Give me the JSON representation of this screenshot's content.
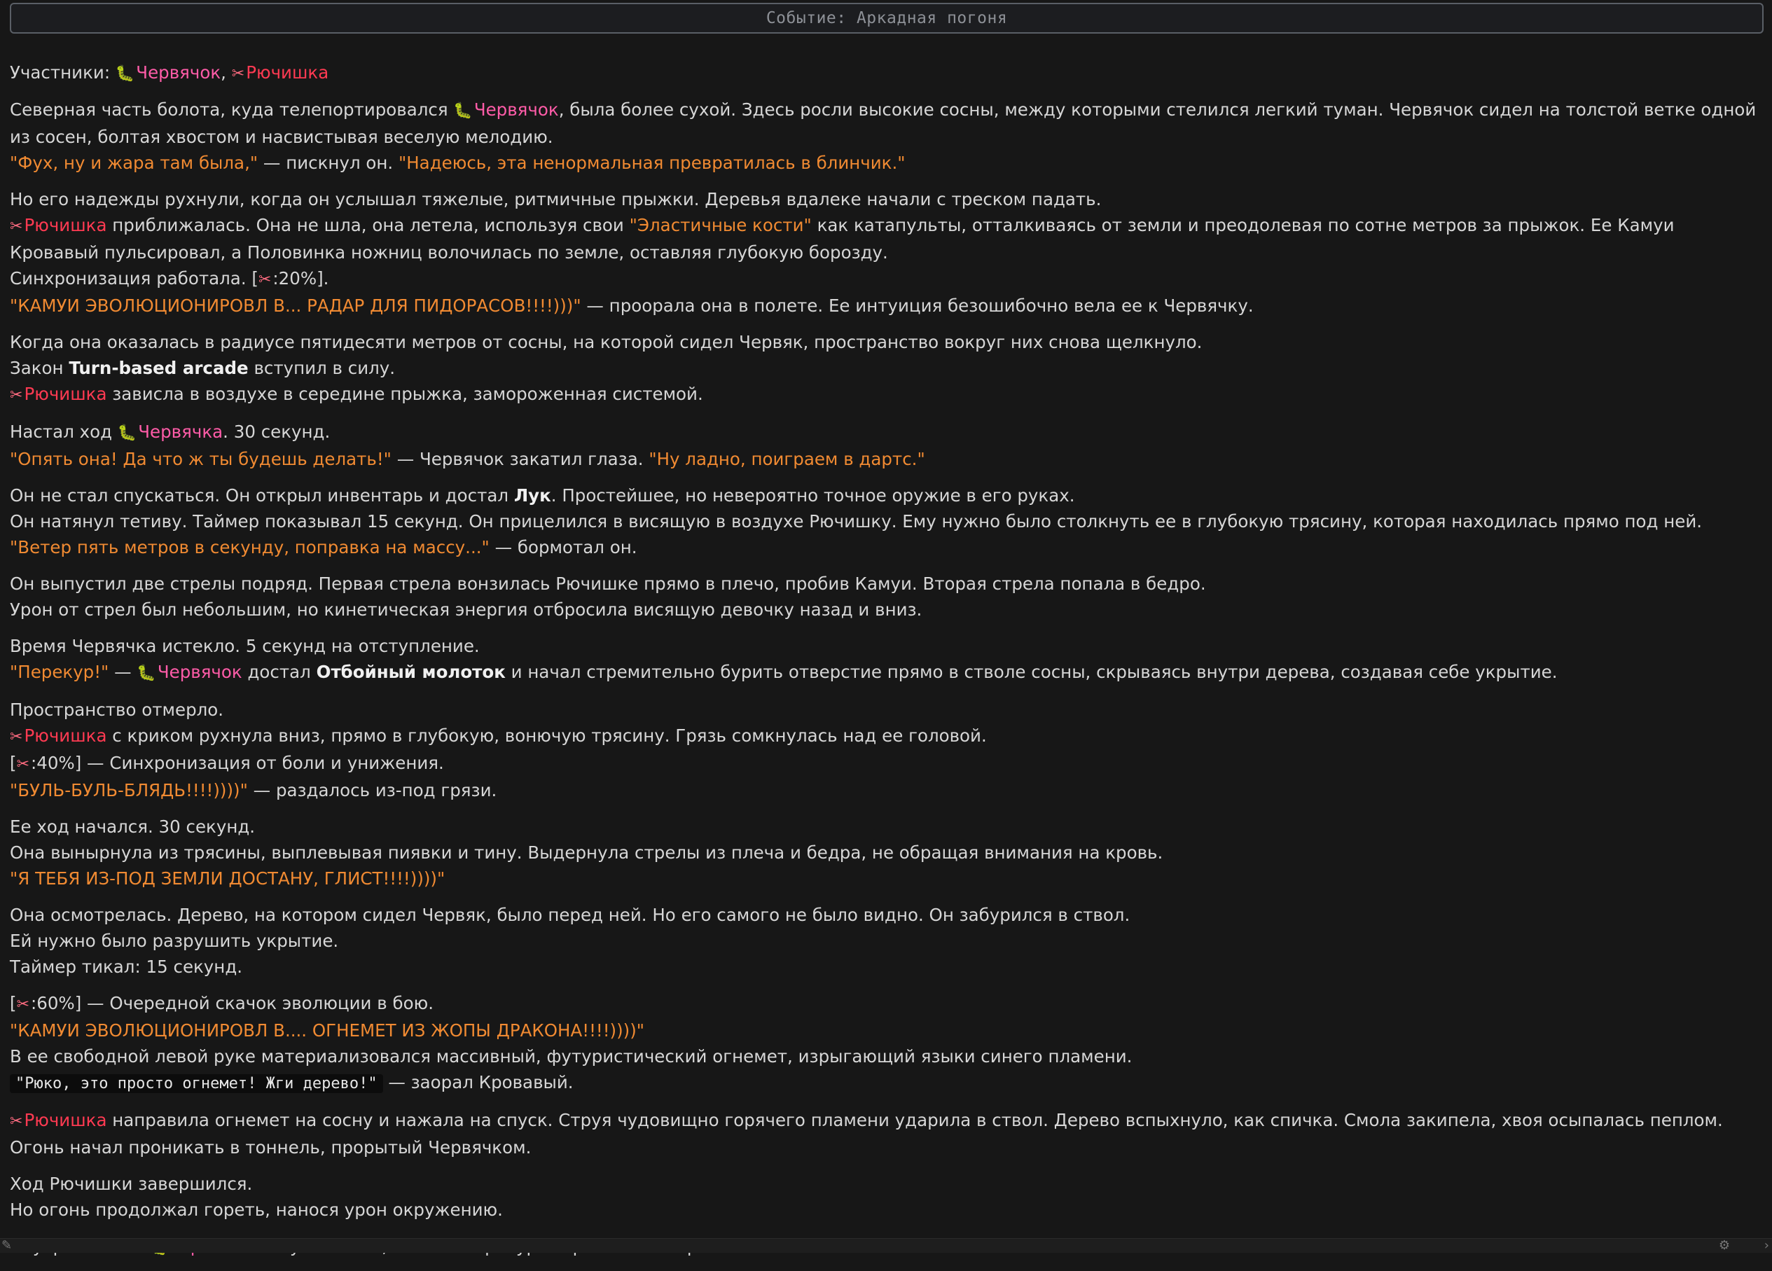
{
  "header": {
    "title": "Событие: Аркадная погоня"
  },
  "names": {
    "worm": "Червячок",
    "worm_gen": "Червячка",
    "ryu": "Рючишка"
  },
  "icons": {
    "worm": "caterpillar-icon",
    "ryu": "scissors-icon"
  },
  "colors": {
    "quote": "#f08a32",
    "worm_name": "#ff5ca8",
    "ryu_name": "#ff3a52",
    "background": "#171717"
  },
  "text": {
    "participants_label": "Участники:",
    "comma": ",",
    "p2_pre": "Северная часть болота, куда телепортировался",
    "p2_post": ", была более сухой. Здесь росли высокие сосны, между которыми стелился легкий туман. Червячок сидел на толстой ветке одной из сосен, болтая хвостом и насвистывая веселую мелодию.",
    "p2_q1": "\"Фух, ну и жара там была,\"",
    "p2_mid": " — пискнул он. ",
    "p2_q2": "\"Надеюсь, эта ненормальная превратилась в блинчик.\"",
    "p3_l1": "Но его надежды рухнули, когда он услышал тяжелые, ритмичные прыжки. Деревья вдалеке начали с треском падать.",
    "p3_l2a": " приближалась. Она не шла, она летела, используя свои ",
    "p3_q1": "\"Эластичные кости\"",
    "p3_l2b": " как катапульты, отталкиваясь от земли и преодолевая по сотне метров за прыжок. Ее Камуи Кровавый пульсировал, а Половинка ножниц волочилась по земле, оставляя глубокую борозду.",
    "p3_l4a": "Синхронизация работала. [",
    "p3_l4b": ":20%].",
    "p3_q2": "\"КАМУИ ЭВОЛЮЦИОНИРОВЛ В... РАДАР ДЛЯ ПИДОРАСОВ!!!!)))\"",
    "p3_l5b": " — проорала она в полете. Ее интуиция безошибочно вела ее к Червячку.",
    "p4_l1": "Когда она оказалась в радиусе пятидесяти метров от сосны, на которой сидел Червяк, пространство вокруг них снова щелкнуло.",
    "p4_l2a": "Закон ",
    "p4_l2b": "Turn-based arcade",
    "p4_l2c": " вступил в силу.",
    "p4_l3": " зависла в воздухе в середине прыжка, замороженная системой.",
    "p5_l1a": "Настал ход ",
    "p5_l1b": ". 30 секунд.",
    "p5_q1": "\"Опять она! Да что ж ты будешь делать!\"",
    "p5_mid": " — Червячок закатил глаза. ",
    "p5_q2": "\"Ну ладно, поиграем в дартс.\"",
    "p6_l1a": "Он не стал спускаться. Он открыл инвентарь и достал ",
    "p6_l1b": "Лук",
    "p6_l1c": ". Простейшее, но невероятно точное оружие в его руках.",
    "p6_l2": "Он натянул тетиву. Таймер показывал 15 секунд. Он прицелился в висящую в воздухе Рючишку. Ему нужно было столкнуть ее в глубокую трясину, которая находилась прямо под ней.",
    "p6_q1": "\"Ветер пять метров в секунду, поправка на массу...\"",
    "p6_l3b": " — бормотал он.",
    "p7_l1": "Он выпустил две стрелы подряд. Первая стрела вонзилась Рючишке прямо в плечо, пробив Камуи. Вторая стрела попала в бедро.",
    "p7_l2": "Урон от стрел был небольшим, но кинетическая энергия отбросила висящую девочку назад и вниз.",
    "p8_l1": "Время Червячка истекло. 5 секунд на отступление.",
    "p8_q1": "\"Перекур!\"",
    "p8_dash": " — ",
    "p8_l2a": " достал ",
    "p8_l2b": "Отбойный молоток",
    "p8_l2c": " и начал стремительно бурить отверстие прямо в стволе сосны, скрываясь внутри дерева, создавая себе укрытие.",
    "p9_l1": "Пространство отмерло.",
    "p9_l2": " с криком рухнула вниз, прямо в глубокую, вонючую трясину. Грязь сомкнулась над ее головой.",
    "bracket_open": "[",
    "p9_l3b": ":40%] — Синхронизация от боли и унижения.",
    "p9_q1": "\"БУЛЬ-БУЛЬ-БЛЯДЬ!!!!))))\"",
    "p9_l4b": " — раздалось из-под грязи.",
    "p10_l1": "Ее ход начался. 30 секунд.",
    "p10_l2": "Она вынырнула из трясины, выплевывая пиявки и тину. Выдернула стрелы из плеча и бедра, не обращая внимания на кровь.",
    "p10_q1": "\"Я ТЕБЯ ИЗ-ПОД ЗЕМЛИ ДОСТАНУ, ГЛИСТ!!!!))))\"",
    "p11_l1": "Она осмотрелась. Дерево, на котором сидел Червяк, было перед ней. Но его самого не было видно. Он забурился в ствол.",
    "p11_l2": "Ей нужно было разрушить укрытие.",
    "p11_l3": "Таймер тикал: 15 секунд.",
    "p12_l1b": ":60%] — Очередной скачок эволюции в бою.",
    "p12_q1": "\"КАМУИ ЭВОЛЮЦИОНИРОВЛ В.... ОГНЕМЕТ ИЗ ЖОПЫ ДРАКОНА!!!!))))\"",
    "p12_l3": "В ее свободной левой руке материализовался массивный, футуристический огнемет, изрыгающий языки синего пламени.",
    "p12_code": "\"Рюко, это просто огнемет! Жги дерево!\"",
    "p12_l4b": " — заорал Кровавый.",
    "p13_l1": " направила огнемет на сосну и нажала на спуск. Струя чудовищно горячего пламени ударила в ствол. Дерево вспыхнуло, как спичка. Смола закипела, хвоя осыпалась пеплом. Огонь начал проникать в тоннель, прорытый Червячком.",
    "p14_l1": "Ход Рючишки завершился.",
    "p14_l2": "Но огонь продолжал гореть, нанося урон окружению.",
    "p15_l1a": "Внутри ствола ",
    "p15_l1b": " почувствовал, как температура стремительно растет."
  }
}
